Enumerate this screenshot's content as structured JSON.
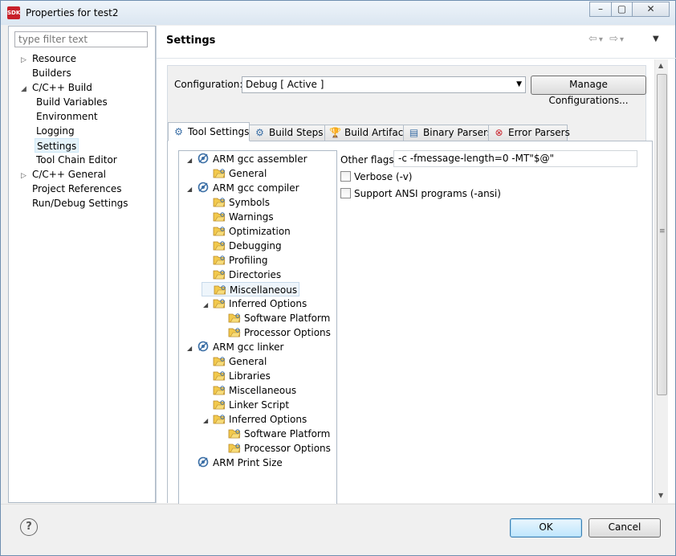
{
  "window": {
    "title": "Properties for test2",
    "icon_label": "SDK",
    "minimize": "–",
    "maximize": "▢",
    "close": "✕"
  },
  "left_nav": {
    "filter_placeholder": "type filter text",
    "items": [
      {
        "label": "Resource",
        "toggle": "▷"
      },
      {
        "label": "Builders",
        "toggle": ""
      },
      {
        "label": "C/C++ Build",
        "toggle": "◢"
      },
      {
        "label": "Build Variables",
        "toggle": ""
      },
      {
        "label": "Environment",
        "toggle": ""
      },
      {
        "label": "Logging",
        "toggle": ""
      },
      {
        "label": "Settings",
        "toggle": ""
      },
      {
        "label": "Tool Chain Editor",
        "toggle": ""
      },
      {
        "label": "C/C++ General",
        "toggle": "▷"
      },
      {
        "label": "Project References",
        "toggle": ""
      },
      {
        "label": "Run/Debug Settings",
        "toggle": ""
      }
    ]
  },
  "header": {
    "title": "Settings",
    "back_glyph": "⇦",
    "forward_glyph": "⇨",
    "dropdown_glyph": "▾",
    "menu_glyph": "▼"
  },
  "configuration": {
    "label": "Configuration:",
    "value": "Debug  [ Active ]",
    "arrow": "▼",
    "manage_button": "Manage Configurations..."
  },
  "tabs": [
    {
      "label": "Tool Settings",
      "icon": "tool-settings-icon",
      "glyph": "⚙"
    },
    {
      "label": "Build Steps",
      "icon": "build-steps-icon",
      "glyph": "⚙"
    },
    {
      "label": "Build Artifact",
      "icon": "build-artifact-icon",
      "glyph": "🏆"
    },
    {
      "label": "Binary Parsers",
      "icon": "binary-parsers-icon",
      "glyph": "▤"
    },
    {
      "label": "Error Parsers",
      "icon": "error-parsers-icon",
      "glyph": "⊗"
    }
  ],
  "tool_tree": [
    {
      "label": "ARM gcc assembler",
      "level": 0,
      "toggle": "◢",
      "icon": "tool-icon"
    },
    {
      "label": "General",
      "level": 1,
      "toggle": "",
      "icon": "folder-icon"
    },
    {
      "label": "ARM gcc compiler",
      "level": 0,
      "toggle": "◢",
      "icon": "tool-icon"
    },
    {
      "label": "Symbols",
      "level": 1,
      "toggle": "",
      "icon": "folder-icon"
    },
    {
      "label": "Warnings",
      "level": 1,
      "toggle": "",
      "icon": "folder-icon"
    },
    {
      "label": "Optimization",
      "level": 1,
      "toggle": "",
      "icon": "folder-icon"
    },
    {
      "label": "Debugging",
      "level": 1,
      "toggle": "",
      "icon": "folder-icon"
    },
    {
      "label": "Profiling",
      "level": 1,
      "toggle": "",
      "icon": "folder-icon"
    },
    {
      "label": "Directories",
      "level": 1,
      "toggle": "",
      "icon": "folder-icon"
    },
    {
      "label": "Miscellaneous",
      "level": 1,
      "toggle": "",
      "icon": "folder-icon",
      "selected": true
    },
    {
      "label": "Inferred Options",
      "level": 1,
      "toggle": "◢",
      "icon": "folder-icon"
    },
    {
      "label": "Software Platform",
      "level": 2,
      "toggle": "",
      "icon": "folder-icon"
    },
    {
      "label": "Processor Options",
      "level": 2,
      "toggle": "",
      "icon": "folder-icon"
    },
    {
      "label": "ARM gcc linker",
      "level": 0,
      "toggle": "◢",
      "icon": "tool-icon"
    },
    {
      "label": "General",
      "level": 1,
      "toggle": "",
      "icon": "folder-icon"
    },
    {
      "label": "Libraries",
      "level": 1,
      "toggle": "",
      "icon": "folder-icon"
    },
    {
      "label": "Miscellaneous",
      "level": 1,
      "toggle": "",
      "icon": "folder-icon"
    },
    {
      "label": "Linker Script",
      "level": 1,
      "toggle": "",
      "icon": "folder-icon"
    },
    {
      "label": "Inferred Options",
      "level": 1,
      "toggle": "◢",
      "icon": "folder-icon"
    },
    {
      "label": "Software Platform",
      "level": 2,
      "toggle": "",
      "icon": "folder-icon"
    },
    {
      "label": "Processor Options",
      "level": 2,
      "toggle": "",
      "icon": "folder-icon"
    },
    {
      "label": "ARM Print Size",
      "level": 0,
      "toggle": "",
      "icon": "tool-icon"
    }
  ],
  "options": {
    "other_flags_label": "Other flags",
    "other_flags_value": "-c -fmessage-length=0 -MT\"$@\"",
    "verbose_label": "Verbose (-v)",
    "verbose_checked": false,
    "ansi_label": "Support ANSI programs (-ansi)",
    "ansi_checked": false
  },
  "scrollbar": {
    "up": "▲",
    "down": "▼",
    "grip": "≡"
  },
  "footer": {
    "help_glyph": "?",
    "ok_label": "OK",
    "cancel_label": "Cancel"
  },
  "colors": {
    "selection": "#e5f3fb",
    "ok_border": "#3c7fb1",
    "icon_red": "#c8202a"
  }
}
